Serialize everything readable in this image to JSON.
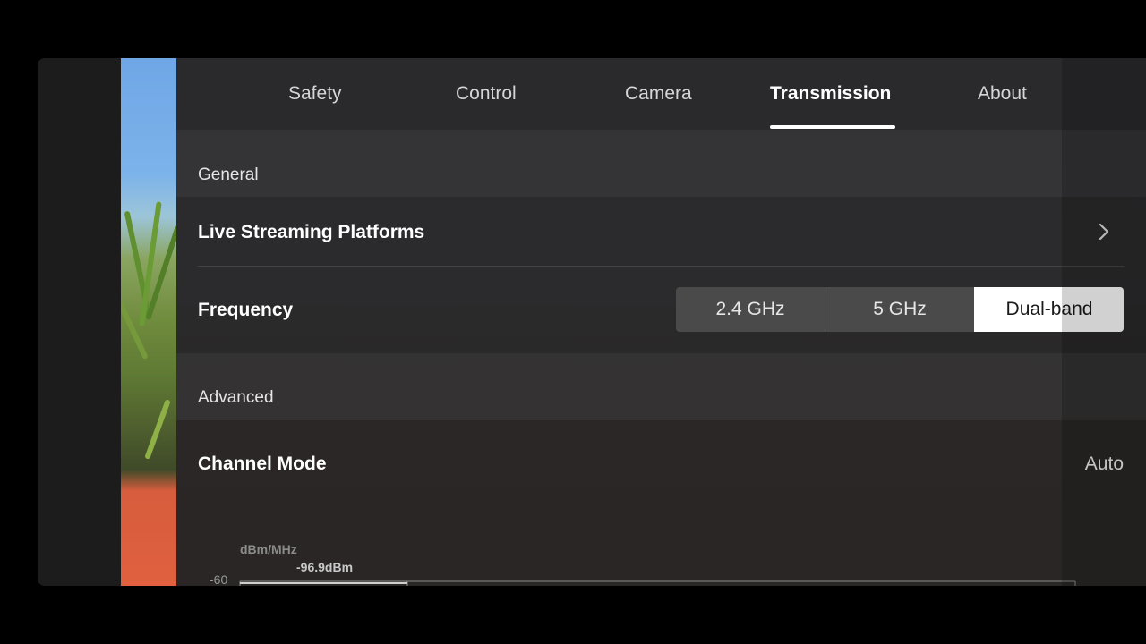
{
  "tabs": [
    {
      "label": "Safety",
      "active": false
    },
    {
      "label": "Control",
      "active": false
    },
    {
      "label": "Camera",
      "active": false
    },
    {
      "label": "Transmission",
      "active": true
    },
    {
      "label": "About",
      "active": false
    }
  ],
  "sections": {
    "general": {
      "title": "General",
      "live_streaming": {
        "label": "Live Streaming Platforms",
        "icon": "chevron-right-icon"
      },
      "frequency": {
        "label": "Frequency",
        "options": [
          "2.4 GHz",
          "5 GHz",
          "Dual-band"
        ],
        "selected": "Dual-band"
      }
    },
    "advanced": {
      "title": "Advanced",
      "channel_mode": {
        "label": "Channel Mode",
        "value": "Auto"
      }
    }
  },
  "spectrum_chart": {
    "unit_label": "dBm/MHz",
    "peak_label": "-96.9dBm",
    "tick_label": "-60"
  },
  "colors": {
    "accent": "#ffffff",
    "selected_segment_bg": "#ffffff",
    "panel_bg": "#2a2a2c"
  }
}
